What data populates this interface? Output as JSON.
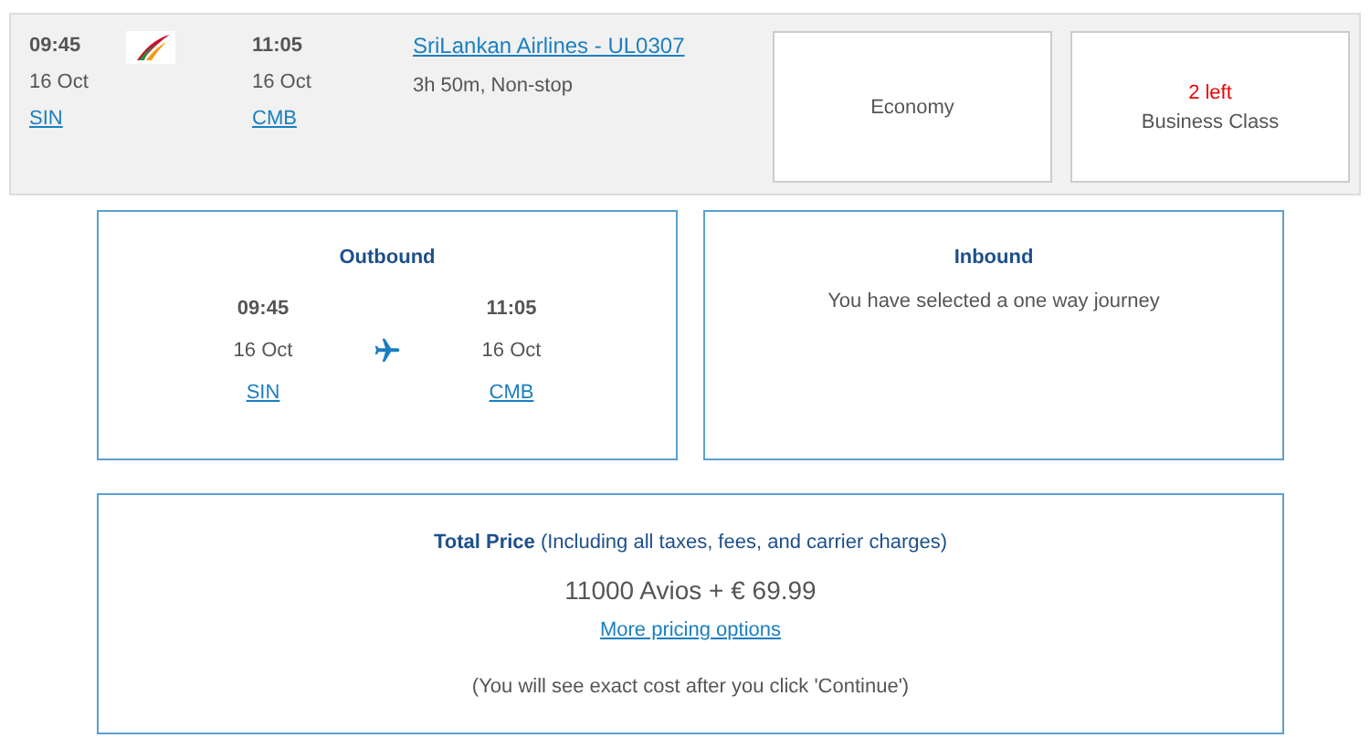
{
  "flight": {
    "departure": {
      "time": "09:45",
      "date": "16 Oct",
      "airport": "SIN"
    },
    "arrival": {
      "time": "11:05",
      "date": "16 Oct",
      "airport": "CMB"
    },
    "airline_flight": "SriLankan Airlines - UL0307",
    "duration": "3h 50m, Non-stop",
    "fares": [
      {
        "cabin": "Economy"
      },
      {
        "availability": "2 left",
        "cabin": "Business Class"
      }
    ]
  },
  "journeys": [
    {
      "kind": "flight",
      "title": "Outbound",
      "departure": {
        "time": "09:45",
        "date": "16 Oct",
        "airport": "SIN"
      },
      "arrival": {
        "time": "11:05",
        "date": "16 Oct",
        "airport": "CMB"
      }
    },
    {
      "kind": "message",
      "title": "Inbound",
      "message": "You have selected a one way journey"
    }
  ],
  "price": {
    "heading": "**Total Price** (Including all taxes, fees, and carrier charges)",
    "amount": "11000 Avios + € 69.99",
    "link": "More pricing options",
    "note": "(You will see exact cost after you click 'Continue')"
  }
}
